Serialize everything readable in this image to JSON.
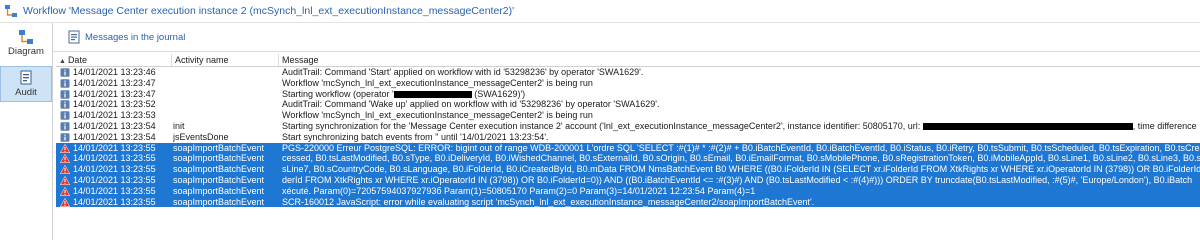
{
  "window": {
    "title": "Workflow 'Message Center execution instance 2 (mcSynch_lnl_ext_executionInstance_messageCenter2)'"
  },
  "nav": {
    "items": [
      {
        "label": "Diagram",
        "icon": "diagram-icon",
        "active": false
      },
      {
        "label": "Audit",
        "icon": "audit-icon",
        "active": true
      }
    ]
  },
  "toolbar": {
    "journal_label": "Messages in the journal",
    "journal_icon": "journal-icon"
  },
  "grid": {
    "columns": [
      "Date",
      "Activity name",
      "Message"
    ],
    "sort_column": "Date",
    "sort_direction": "ascending",
    "rows": [
      {
        "type": "info",
        "date": "14/01/2021 13:23:46",
        "activity": "",
        "message": "AuditTrail: Command 'Start' applied on workflow with id '53298236' by operator 'SWA1629'."
      },
      {
        "type": "info",
        "date": "14/01/2021 13:23:47",
        "activity": "",
        "message": "Workflow 'mcSynch_lnl_ext_executionInstance_messageCenter2' is being run"
      },
      {
        "type": "info",
        "date": "14/01/2021 13:23:47",
        "activity": "",
        "message_pre": "Starting workflow (operator '",
        "message_post": " (SWA1629)')"
      },
      {
        "type": "info",
        "date": "14/01/2021 13:23:52",
        "activity": "",
        "message": "AuditTrail: Command 'Wake up' applied on workflow with id '53298236' by operator 'SWA1629'."
      },
      {
        "type": "info",
        "date": "14/01/2021 13:23:53",
        "activity": "",
        "message": "Workflow 'mcSynch_lnl_ext_executionInstance_messageCenter2' is being run"
      },
      {
        "type": "info",
        "date": "14/01/2021 13:23:54",
        "activity": "init",
        "message_pre": "Starting synchronization for the 'Message Center execution instance 2' account ('lnl_ext_executionInstance_messageCenter2', instance identifier: 50805170, url: ",
        "message_post": ", time difference"
      },
      {
        "type": "info",
        "date": "14/01/2021 13:23:54",
        "activity": "jsEventsDone",
        "message": "Start synchronizing batch events from '' until '14/01/2021 13:23:54'."
      },
      {
        "type": "error",
        "date": "14/01/2021 13:23:55",
        "activity": "soapImportBatchEvent",
        "message": "PGS-220000 Erreur PostgreSQL: ERROR:  bigint out of range  WDB-200001 L'ordre SQL 'SELECT  :#(1)# * :#(2)# + B0.iBatchEventId, B0.iBatchEventId, B0.iStatus, B0.iRetry, B0.tsSubmit, B0.tsScheduled, B0.tsExpiration, B0.tsCreat"
      },
      {
        "type": "error",
        "date": "14/01/2021 13:23:55",
        "activity": "soapImportBatchEvent",
        "message": "cessed, B0.tsLastModified, B0.sType, B0.iDeliveryId, B0.iWishedChannel, B0.sExternalId, B0.sOrigin, B0.sEmail, B0.iEmailFormat, B0.sMobilePhone, B0.sRegistrationToken, B0.iMobileAppId, B0.sLine1, B0.sLine2, B0.sLine3, B0.sLi"
      },
      {
        "type": "error",
        "date": "14/01/2021 13:23:55",
        "activity": "soapImportBatchEvent",
        "message": "sLine7, B0.sCountryCode, B0.sLanguage, B0.iFolderId, B0.iCreatedById, B0.mData FROM NmsBatchEvent B0 WHERE ((B0.iFolderId IN (SELECT xr.iFolderId FROM XtkRights xr WHERE xr.iOperatorId IN (3798)) OR B0.iFolderId=0)"
      },
      {
        "type": "error",
        "date": "14/01/2021 13:23:55",
        "activity": "soapImportBatchEvent",
        "message": "derId FROM XtkRights xr WHERE xr.iOperatorId IN (3798)) OR B0.iFolderId=0)) AND ((B0.iBatchEventId <= :#(3)#) AND (B0.tsLastModified < :#(4)#))) ORDER BY truncdate(B0.tsLastModified, :#(5)#, 'Europe/London'), B0.iBatch"
      },
      {
        "type": "error",
        "date": "14/01/2021 13:23:55",
        "activity": "soapImportBatchEvent",
        "message": "xécuté.  Param(0)=7205759403792793б  Param(1)=50805170  Param(2)=0  Param(3)=14/01/2021 12:23:54  Param(4)=1"
      },
      {
        "type": "error",
        "date": "14/01/2021 13:23:55",
        "activity": "soapImportBatchEvent",
        "message": "SCR-160012 JavaScript: error while evaluating script 'mcSynch_lnl_ext_executionInstance_messageCenter2/soapImportBatchEvent'."
      }
    ]
  },
  "colors": {
    "link_blue": "#2a62b0",
    "error_row_bg": "#1f77d4",
    "active_nav_bg": "#cfe3f7"
  }
}
